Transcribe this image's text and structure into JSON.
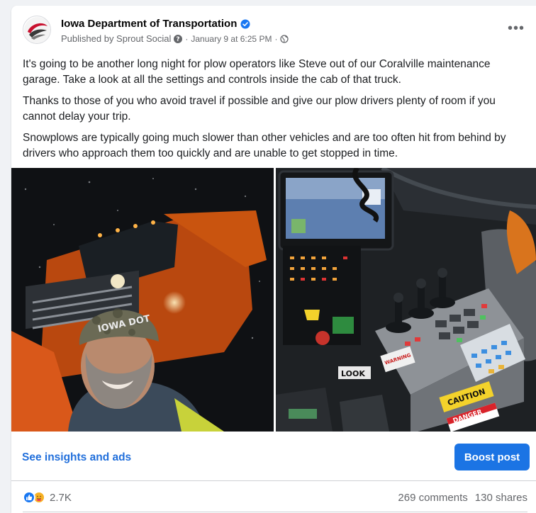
{
  "post": {
    "page_name": "Iowa Department of Transportation",
    "published_by": "Published by Sprout Social",
    "date": "January 9 at 6:25 PM",
    "more_label": "•••",
    "paragraphs": [
      "It's going to be another long night for plow operators like Steve out of our Coralville maintenance garage. Take a look at all the settings and controls inside the cab of that truck.",
      "Thanks to those of you who avoid travel if possible and give our plow drivers plenty of room if you cannot delay your trip.",
      "Snowplows are typically going much slower than other vehicles and are too often hit from behind by drivers who approach them too quickly and are unable to get stopped in time."
    ]
  },
  "photos": {
    "hat_text": "IOWA DOT",
    "label_look": "LOOK",
    "label_warning": "WARNING",
    "label_caution": "CAUTION",
    "label_danger": "DANGER"
  },
  "actions": {
    "insights_label": "See insights and ads",
    "boost_label": "Boost post"
  },
  "footer": {
    "reaction_count": "2.7K",
    "comments": "269 comments",
    "shares": "130 shares"
  },
  "colors": {
    "accent": "#1b74e4",
    "link": "#216fdb",
    "verified": "#1877f2"
  }
}
